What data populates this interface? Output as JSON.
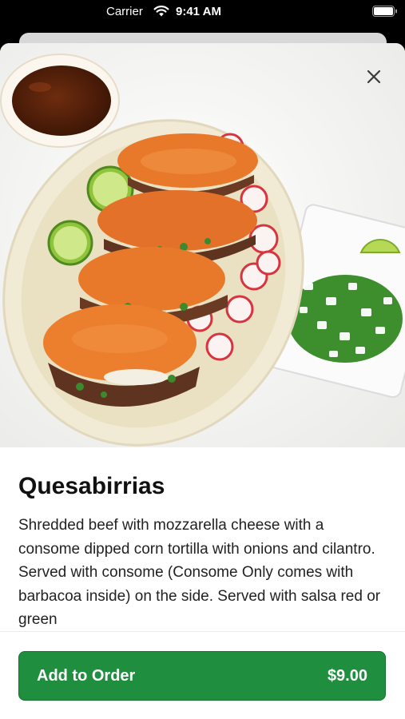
{
  "status_bar": {
    "carrier": "Carrier",
    "time": "9:41 AM"
  },
  "item": {
    "title": "Quesabirrias",
    "description": "Shredded beef with mozzarella cheese with a consome dipped corn tortilla with onions and cilantro. Served with consome (Consome Only comes with barbacoa inside) on the side. Served with salsa red or green"
  },
  "footer": {
    "add_label": "Add to Order",
    "price": "$9.00"
  },
  "colors": {
    "accent": "#1f8f3f",
    "tortilla": "#e8792b"
  },
  "icons": {
    "close": "close-icon",
    "wifi": "wifi-icon",
    "battery": "battery-icon"
  }
}
